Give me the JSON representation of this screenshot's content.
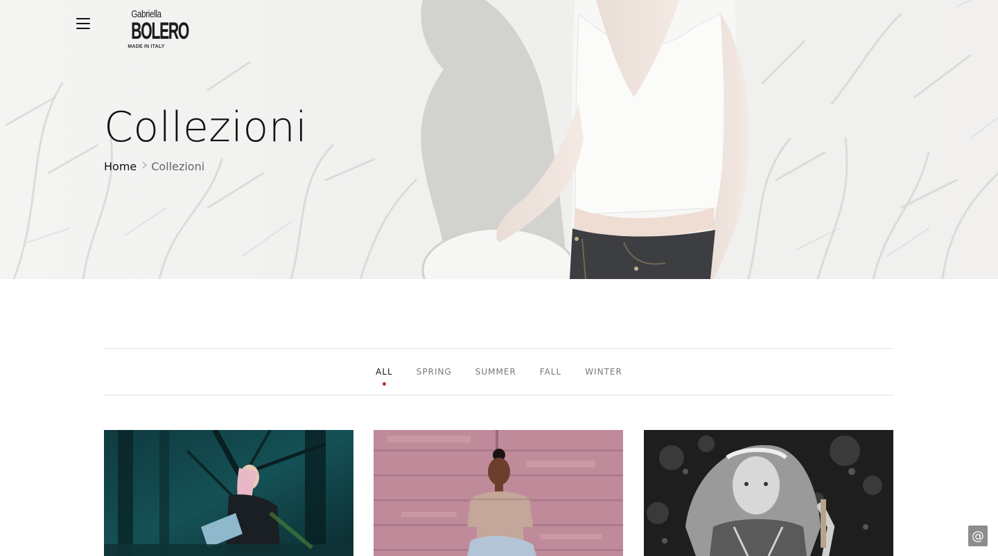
{
  "header": {
    "menu_icon": "hamburger-menu-icon",
    "logo": {
      "line1": "Gabriella",
      "line2": "BOLERO",
      "line3": "MADE IN ITALY"
    }
  },
  "hero": {
    "title": "Collezioni",
    "breadcrumb": {
      "home": "Home",
      "separator_icon": "chevron-right-icon",
      "current": "Collezioni"
    }
  },
  "filters": {
    "tabs": [
      {
        "label": "ALL",
        "active": true
      },
      {
        "label": "SPRING",
        "active": false
      },
      {
        "label": "SUMMER",
        "active": false
      },
      {
        "label": "FALL",
        "active": false
      },
      {
        "label": "WINTER",
        "active": false
      }
    ],
    "accent_color": "#b4331f"
  },
  "gallery": {
    "items": [
      {
        "image": "woman-in-teal-forest-photo"
      },
      {
        "image": "woman-against-pink-wooden-wall-photo"
      },
      {
        "image": "black-and-white-woman-with-flower-crown-photo"
      }
    ]
  },
  "contact_button": {
    "icon": "at-sign-icon",
    "glyph": "@"
  }
}
